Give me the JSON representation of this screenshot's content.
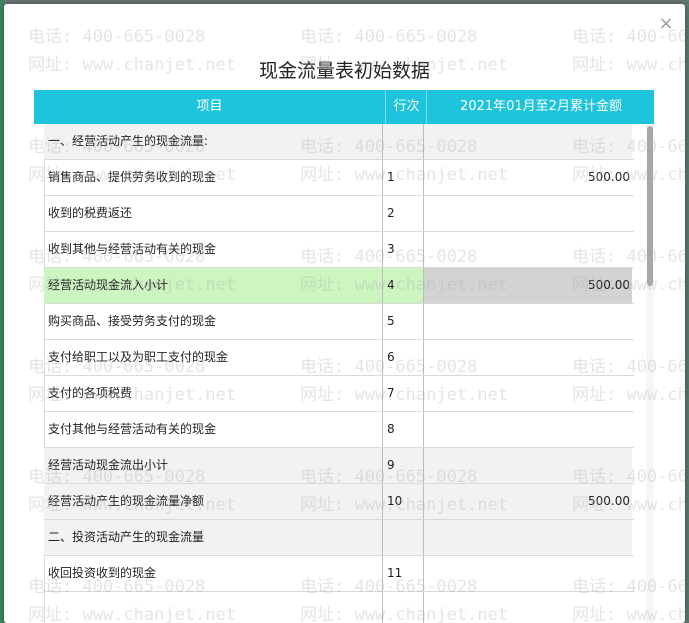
{
  "dialog": {
    "title": "现金流量表初始数据",
    "close_glyph": "×"
  },
  "table": {
    "headers": [
      "项目",
      "行次",
      "2021年01月至2月累计金额"
    ],
    "rows": [
      {
        "item": "一、经营活动产生的现金流量:",
        "line": "",
        "amount": ""
      },
      {
        "item": "销售商品、提供劳务收到的现金",
        "line": "1",
        "amount": "500.00"
      },
      {
        "item": "收到的税费返还",
        "line": "2",
        "amount": ""
      },
      {
        "item": "收到其他与经营活动有关的现金",
        "line": "3",
        "amount": ""
      },
      {
        "item": "经营活动现金流入小计",
        "line": "4",
        "amount": "500.00"
      },
      {
        "item": "购买商品、接受劳务支付的现金",
        "line": "5",
        "amount": ""
      },
      {
        "item": "支付给职工以及为职工支付的现金",
        "line": "6",
        "amount": ""
      },
      {
        "item": "支付的各项税费",
        "line": "7",
        "amount": ""
      },
      {
        "item": "支付其他与经营活动有关的现金",
        "line": "8",
        "amount": ""
      },
      {
        "item": "经营活动现金流出小计",
        "line": "9",
        "amount": ""
      },
      {
        "item": "经营活动产生的现金流量净额",
        "line": "10",
        "amount": "500.00"
      },
      {
        "item": "二、投资活动产生的现金流量",
        "line": "",
        "amount": ""
      },
      {
        "item": "收回投资收到的现金",
        "line": "11",
        "amount": ""
      },
      {
        "item": "",
        "line": "",
        "amount": ""
      }
    ]
  },
  "watermark": {
    "phone": "电话: 400-665-0028",
    "site": "网址: www.chanjet.net"
  },
  "colors": {
    "header_bg": "#1ec4dc",
    "highlight_green": "#ccf5c0",
    "highlight_grey": "#d3d3d3"
  }
}
